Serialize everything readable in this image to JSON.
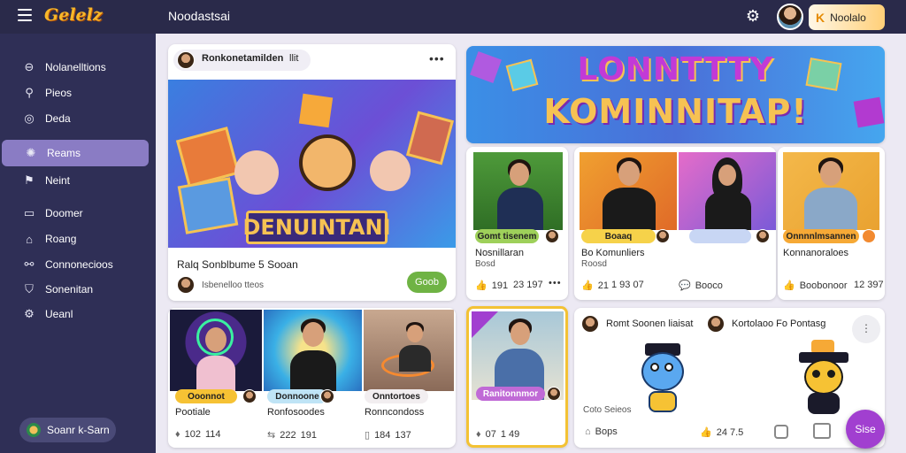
{
  "app": {
    "logo": "Gelelz",
    "title": "Noodastsai"
  },
  "topbar": {
    "cta_label": "Noolalo",
    "cta_icon": "K"
  },
  "sidebar": {
    "items": [
      {
        "label": "Nolanelltions",
        "icon": "circle-minus-icon"
      },
      {
        "label": "Pieos",
        "icon": "pin-icon"
      },
      {
        "label": "Deda",
        "icon": "target-icon"
      },
      {
        "label": "Reams",
        "icon": "gear-badge-icon",
        "active": true
      },
      {
        "label": "Neint",
        "icon": "flag-icon"
      },
      {
        "label": "Doomer",
        "icon": "folder-icon"
      },
      {
        "label": "Roang",
        "icon": "bookmark-icon"
      },
      {
        "label": "Connonecioos",
        "icon": "link-icon"
      },
      {
        "label": "Sonenitan",
        "icon": "shield-icon"
      },
      {
        "label": "Ueanl",
        "icon": "cog-icon"
      }
    ],
    "user_label": "Soanr k-Sarn"
  },
  "feature_card": {
    "author": "Ronkonetamilden",
    "author_tag": "llit",
    "banner_text": "DENUINTANI",
    "title": "Ralq Sonblbume 5 Sooan",
    "meta": "Isbenelloo tteos",
    "button": "Goob"
  },
  "hero": {
    "line1": "LONNTTTY",
    "line2": "KOMINNITAP!"
  },
  "mid_cards": [
    {
      "badge": "Gomt tisenem",
      "title": "Nosnillaran",
      "sub": "Bosd",
      "stat1": "191",
      "stat2": "23 197"
    },
    {
      "badge": "Boaaq",
      "title": "Bo Komunliers",
      "sub": "Roosd",
      "stat1": "21",
      "stat2": "1 93 07",
      "stat3": "Booco"
    },
    {
      "badge": "Onnnnlmsannen",
      "title": "Konnanoraloes",
      "stat1": "Boobonoor",
      "stat2": "12 397"
    }
  ],
  "bottom_cards": [
    {
      "badge": "Ooonnot",
      "title": "Pootiale",
      "stat1": "102",
      "stat2": "114"
    },
    {
      "badge": "Donnoone",
      "title": "Ronfosoodes",
      "stat1": "222",
      "stat2": "191"
    },
    {
      "badge": "Onntortoes",
      "title": "Ronncondoss",
      "stat1": "184",
      "stat2": "137"
    }
  ],
  "highlight_card": {
    "badge": "Ranitonnmor",
    "stat1": "07",
    "stat2": "1 49"
  },
  "mascot_card": {
    "author1": "Romt Soonen liaisat",
    "author2": "Kortolaoo Fo Pontasg",
    "sub": "Coto Seieos",
    "action": "Bops",
    "stat": "24 7.5",
    "fab": "Sise"
  },
  "colors": {
    "topbar": "#2a2a4a",
    "sidebar": "#2f2f56",
    "active_nav": "#8a7cc4",
    "accent_purple": "#a13fd0",
    "accent_green": "#6fb344",
    "accent_yellow": "#f3c234"
  }
}
